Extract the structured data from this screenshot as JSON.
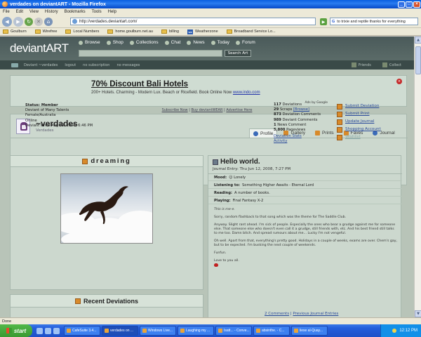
{
  "window": {
    "title": "verdades on deviantART - Mozilla Firefox"
  },
  "menu": [
    "File",
    "Edit",
    "View",
    "History",
    "Bookmarks",
    "Tools",
    "Help"
  ],
  "nav": {
    "url": "http://verdades.deviantart.com/",
    "search_value": "to trixie and reptile thanks for everything"
  },
  "bookmarks": [
    "Goulburn",
    "Wirefree",
    "Local Numbers",
    "home.goulburn.net.au",
    "billing",
    "Weatherzone",
    "Broadband Service Lo..."
  ],
  "site": {
    "logo": "deviantART",
    "nav_items": [
      "Browse",
      "Shop",
      "Collections",
      "Chat",
      "News",
      "Today",
      "Forum"
    ],
    "search_button": "Search Art",
    "userbar": [
      "Deviant ~verdades",
      "logout",
      "no subscription",
      "no messages"
    ],
    "userbar_right": [
      "Friends",
      "Collect"
    ]
  },
  "ad": {
    "title": "70% Discount Bali Hotels",
    "desc": "200+ Hotels. Charming - Modern Lux. Beach or Ricefield. Book Online Now",
    "link": "www.indo.com",
    "google": "Ads by Google",
    "links": [
      "Subscribe Now",
      "Buy deviantWEAR",
      "Advertise Here"
    ]
  },
  "profile": {
    "username": "~verdades",
    "subtitle": "Verdades",
    "tabs": [
      "Profile",
      "Gallery",
      "Prints",
      "Faves",
      "Journal"
    ],
    "info": [
      "Status: Member",
      "Deviant of Many Talents",
      "Female/Australia",
      "Online",
      "Deviant since Aug 19, 2006, 6:46 PM"
    ],
    "stats": [
      {
        "num": "117",
        "label": "Deviations"
      },
      {
        "num": "29",
        "label": "Scraps",
        "extra": "[Browse]"
      },
      {
        "num": "873",
        "label": "Deviation Comments"
      },
      {
        "num": "989",
        "label": "Deviant Comments"
      },
      {
        "num": "1",
        "label": "News Comment"
      },
      {
        "num": "5,800",
        "label": "Pageviews"
      }
    ],
    "stat_links": [
      "Deviation Stats",
      "Activity"
    ],
    "actions": [
      "Submit Deviation",
      "Submit Print",
      "Update Journal",
      "Shopping Account",
      "Wishlist"
    ]
  },
  "featured": {
    "title": "dreaming"
  },
  "recent": {
    "title": "Recent Deviations"
  },
  "journal": {
    "title": "Hello world.",
    "date": "Journal Entry: Thu Jun 12, 2008, 7:27 PM",
    "meta": [
      {
        "label": "Mood:",
        "value": "Lonely"
      },
      {
        "label": "Listening to:",
        "value": "Something Higher Awaits - Eternal Lord"
      },
      {
        "label": "Reading:",
        "value": "A number of books."
      },
      {
        "label": "Playing:",
        "value": "Final Fantasy X-2"
      }
    ],
    "intro": "This is me-e.",
    "paragraphs": [
      "Sorry, random flashback to that song which was the theme for The Saddle Club.",
      "Anyway. Slight rant ahead. I'm sick of people. Especially the ones who bear a grudge against me for someone else. That someone else who doesn't even call it a grudge, still friends with, etc. And his best friend still talks to me too. Damn bitch. And spread rumours about me... Lucky I'm not vengeful.",
      "Oh well. Apart from that, everything's pretty good. Holidays in a couple of weeks, exams are over. Chem's gay, but to be expected. I'm busking the next couple of weekends.",
      "Funfun.",
      "Love to you all."
    ],
    "comments_link": "2 Comments",
    "prev_link": "Previous Journal Entries"
  },
  "status": "Done",
  "taskbar": {
    "start": "start",
    "tasks": [
      "CafeSuite 3.4...",
      "verdades on ...",
      "Windows Live...",
      "Laughing my ...",
      "Isatt... - Conve...",
      "absinthe. - C...",
      "liese al-Quay..."
    ],
    "clock": "12:12 PM"
  }
}
